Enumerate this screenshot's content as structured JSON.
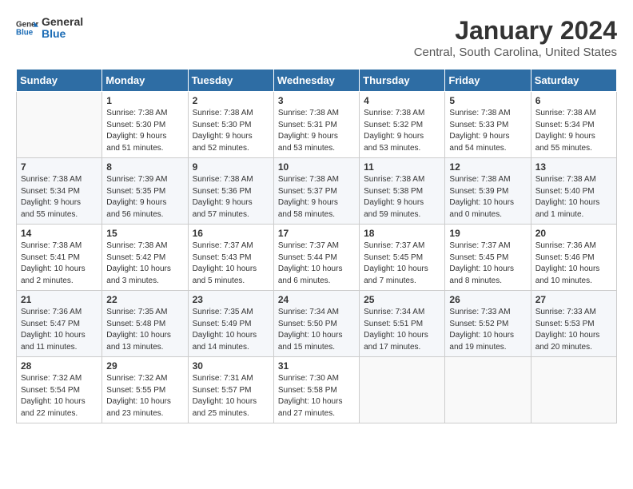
{
  "logo": {
    "line1": "General",
    "line2": "Blue"
  },
  "title": "January 2024",
  "subtitle": "Central, South Carolina, United States",
  "days_header": [
    "Sunday",
    "Monday",
    "Tuesday",
    "Wednesday",
    "Thursday",
    "Friday",
    "Saturday"
  ],
  "weeks": [
    [
      {
        "num": "",
        "info": ""
      },
      {
        "num": "1",
        "info": "Sunrise: 7:38 AM\nSunset: 5:30 PM\nDaylight: 9 hours\nand 51 minutes."
      },
      {
        "num": "2",
        "info": "Sunrise: 7:38 AM\nSunset: 5:30 PM\nDaylight: 9 hours\nand 52 minutes."
      },
      {
        "num": "3",
        "info": "Sunrise: 7:38 AM\nSunset: 5:31 PM\nDaylight: 9 hours\nand 53 minutes."
      },
      {
        "num": "4",
        "info": "Sunrise: 7:38 AM\nSunset: 5:32 PM\nDaylight: 9 hours\nand 53 minutes."
      },
      {
        "num": "5",
        "info": "Sunrise: 7:38 AM\nSunset: 5:33 PM\nDaylight: 9 hours\nand 54 minutes."
      },
      {
        "num": "6",
        "info": "Sunrise: 7:38 AM\nSunset: 5:34 PM\nDaylight: 9 hours\nand 55 minutes."
      }
    ],
    [
      {
        "num": "7",
        "info": "Sunrise: 7:38 AM\nSunset: 5:34 PM\nDaylight: 9 hours\nand 55 minutes."
      },
      {
        "num": "8",
        "info": "Sunrise: 7:39 AM\nSunset: 5:35 PM\nDaylight: 9 hours\nand 56 minutes."
      },
      {
        "num": "9",
        "info": "Sunrise: 7:38 AM\nSunset: 5:36 PM\nDaylight: 9 hours\nand 57 minutes."
      },
      {
        "num": "10",
        "info": "Sunrise: 7:38 AM\nSunset: 5:37 PM\nDaylight: 9 hours\nand 58 minutes."
      },
      {
        "num": "11",
        "info": "Sunrise: 7:38 AM\nSunset: 5:38 PM\nDaylight: 9 hours\nand 59 minutes."
      },
      {
        "num": "12",
        "info": "Sunrise: 7:38 AM\nSunset: 5:39 PM\nDaylight: 10 hours\nand 0 minutes."
      },
      {
        "num": "13",
        "info": "Sunrise: 7:38 AM\nSunset: 5:40 PM\nDaylight: 10 hours\nand 1 minute."
      }
    ],
    [
      {
        "num": "14",
        "info": "Sunrise: 7:38 AM\nSunset: 5:41 PM\nDaylight: 10 hours\nand 2 minutes."
      },
      {
        "num": "15",
        "info": "Sunrise: 7:38 AM\nSunset: 5:42 PM\nDaylight: 10 hours\nand 3 minutes."
      },
      {
        "num": "16",
        "info": "Sunrise: 7:37 AM\nSunset: 5:43 PM\nDaylight: 10 hours\nand 5 minutes."
      },
      {
        "num": "17",
        "info": "Sunrise: 7:37 AM\nSunset: 5:44 PM\nDaylight: 10 hours\nand 6 minutes."
      },
      {
        "num": "18",
        "info": "Sunrise: 7:37 AM\nSunset: 5:45 PM\nDaylight: 10 hours\nand 7 minutes."
      },
      {
        "num": "19",
        "info": "Sunrise: 7:37 AM\nSunset: 5:45 PM\nDaylight: 10 hours\nand 8 minutes."
      },
      {
        "num": "20",
        "info": "Sunrise: 7:36 AM\nSunset: 5:46 PM\nDaylight: 10 hours\nand 10 minutes."
      }
    ],
    [
      {
        "num": "21",
        "info": "Sunrise: 7:36 AM\nSunset: 5:47 PM\nDaylight: 10 hours\nand 11 minutes."
      },
      {
        "num": "22",
        "info": "Sunrise: 7:35 AM\nSunset: 5:48 PM\nDaylight: 10 hours\nand 13 minutes."
      },
      {
        "num": "23",
        "info": "Sunrise: 7:35 AM\nSunset: 5:49 PM\nDaylight: 10 hours\nand 14 minutes."
      },
      {
        "num": "24",
        "info": "Sunrise: 7:34 AM\nSunset: 5:50 PM\nDaylight: 10 hours\nand 15 minutes."
      },
      {
        "num": "25",
        "info": "Sunrise: 7:34 AM\nSunset: 5:51 PM\nDaylight: 10 hours\nand 17 minutes."
      },
      {
        "num": "26",
        "info": "Sunrise: 7:33 AM\nSunset: 5:52 PM\nDaylight: 10 hours\nand 19 minutes."
      },
      {
        "num": "27",
        "info": "Sunrise: 7:33 AM\nSunset: 5:53 PM\nDaylight: 10 hours\nand 20 minutes."
      }
    ],
    [
      {
        "num": "28",
        "info": "Sunrise: 7:32 AM\nSunset: 5:54 PM\nDaylight: 10 hours\nand 22 minutes."
      },
      {
        "num": "29",
        "info": "Sunrise: 7:32 AM\nSunset: 5:55 PM\nDaylight: 10 hours\nand 23 minutes."
      },
      {
        "num": "30",
        "info": "Sunrise: 7:31 AM\nSunset: 5:57 PM\nDaylight: 10 hours\nand 25 minutes."
      },
      {
        "num": "31",
        "info": "Sunrise: 7:30 AM\nSunset: 5:58 PM\nDaylight: 10 hours\nand 27 minutes."
      },
      {
        "num": "",
        "info": ""
      },
      {
        "num": "",
        "info": ""
      },
      {
        "num": "",
        "info": ""
      }
    ]
  ]
}
